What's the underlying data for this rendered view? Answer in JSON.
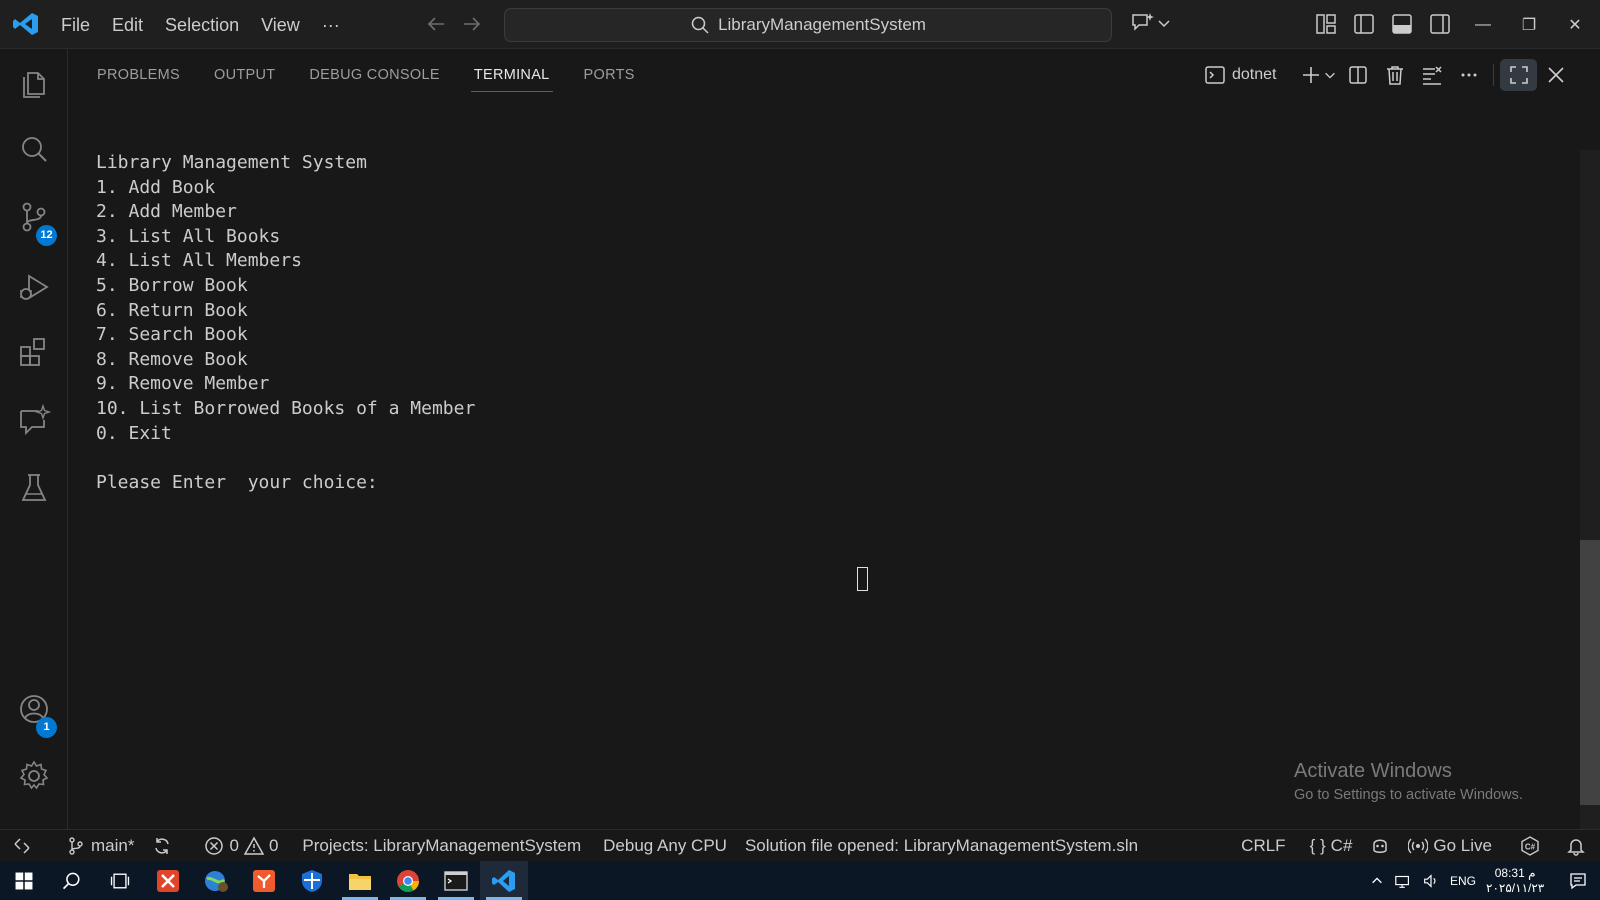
{
  "titlebar": {
    "menu": [
      "File",
      "Edit",
      "Selection",
      "View",
      "···"
    ],
    "search_text": "LibraryManagementSystem",
    "window_controls": {
      "minimize": "—",
      "restore": "❐",
      "close": "✕"
    }
  },
  "activitybar": {
    "items": [
      "explorer-icon",
      "search-icon",
      "source-control-icon",
      "run-debug-icon",
      "extensions-icon",
      "chat-icon",
      "testing-icon"
    ],
    "source_control_badge": "12",
    "accounts_badge": "1"
  },
  "panel": {
    "tabs": [
      "PROBLEMS",
      "OUTPUT",
      "DEBUG CONSOLE",
      "TERMINAL",
      "PORTS"
    ],
    "active_tab": "TERMINAL",
    "terminal_name": "dotnet"
  },
  "terminal": {
    "lines": [
      "Library Management System",
      "1. Add Book",
      "2. Add Member",
      "3. List All Books",
      "4. List All Members",
      "5. Borrow Book",
      "6. Return Book",
      "7. Search Book",
      "8. Remove Book",
      "9. Remove Member",
      "10. List Borrowed Books of a Member",
      "0. Exit",
      "",
      "Please Enter  your choice:"
    ]
  },
  "watermark": {
    "title": "Activate Windows",
    "subtitle": "Go to Settings to activate Windows."
  },
  "statusbar": {
    "branch": "main*",
    "errors": "0",
    "warnings": "0",
    "projects": "Projects: LibraryManagementSystem",
    "debug": "Debug Any CPU",
    "solution": "Solution file opened: LibraryManagementSystem.sln",
    "eol": "CRLF",
    "braces": "{ }",
    "language": "C#",
    "golive": "Go Live"
  },
  "taskbar": {
    "language": "ENG",
    "time": "08:31 م",
    "date": "۲۰۲۵/۱۱/۲۳"
  },
  "colors": {
    "accent": "#0078d4",
    "background": "#181818",
    "taskbar": "#0c1725"
  }
}
